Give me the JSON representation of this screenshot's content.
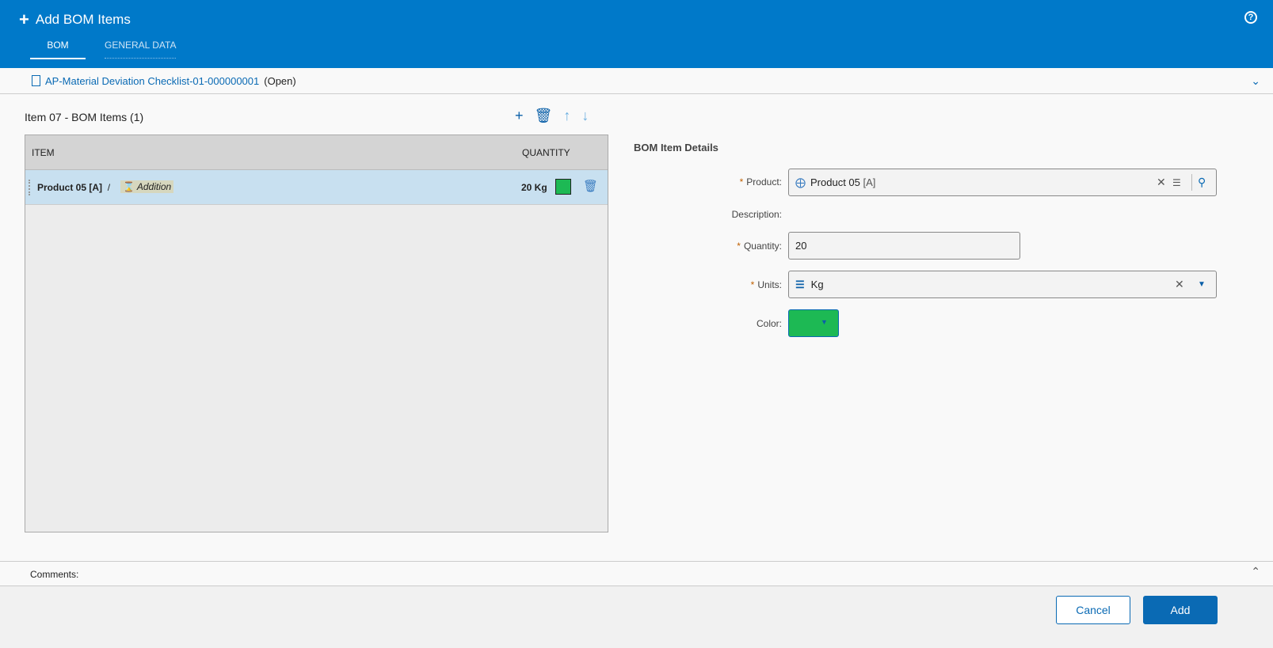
{
  "header": {
    "title": "Add BOM Items",
    "tabs": [
      {
        "label": "BOM"
      },
      {
        "label": "GENERAL DATA"
      }
    ],
    "help": "?"
  },
  "document": {
    "link": "AP-Material Deviation Checklist-01-000000001",
    "status": "(Open)"
  },
  "list": {
    "title": "Item 07 - BOM Items (1)",
    "columns": [
      "ITEM",
      "QUANTITY"
    ],
    "rows": [
      {
        "item": "Product 05 [A]",
        "separator": "/",
        "tag": "Addition",
        "quantity": "20 Kg",
        "color": "#1db954"
      }
    ]
  },
  "details": {
    "title": "BOM Item Details",
    "product_label": "Product:",
    "product_value": "Product 05",
    "product_rev": "[A]",
    "description_label": "Description:",
    "quantity_label": "Quantity:",
    "quantity_value": "20",
    "units_label": "Units:",
    "units_value": "Kg",
    "color_label": "Color:",
    "color_value": "#1db954"
  },
  "comments": {
    "label": "Comments:"
  },
  "footer": {
    "cancel": "Cancel",
    "add": "Add"
  }
}
